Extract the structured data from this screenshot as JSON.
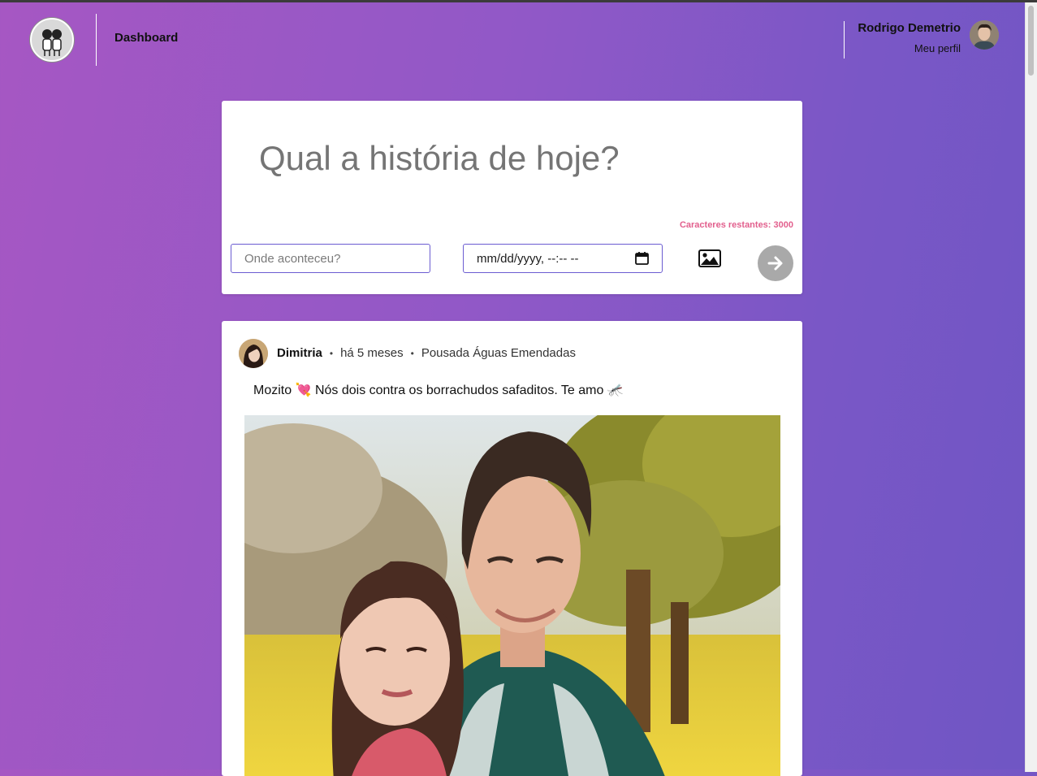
{
  "header": {
    "nav_label": "Dashboard",
    "user_name": "Rodrigo Demetrio",
    "profile_link": "Meu perfil"
  },
  "composer": {
    "story_placeholder": "Qual a história de hoje?",
    "chars_remaining": "Caracteres restantes: 3000",
    "location_placeholder": "Onde aconteceu?",
    "date_placeholder": "mm/dd/yyyy, --:-- --"
  },
  "post": {
    "author": "Dimitria",
    "time": "há 5 meses",
    "location": "Pousada Águas Emendadas",
    "text": "Mozito 💘 Nós dois contra os borrachudos safaditos. Te amo 🦟"
  },
  "colors": {
    "accent": "#6b5cd1",
    "counter": "#e25f8d",
    "send_button": "#a9a9a9"
  }
}
